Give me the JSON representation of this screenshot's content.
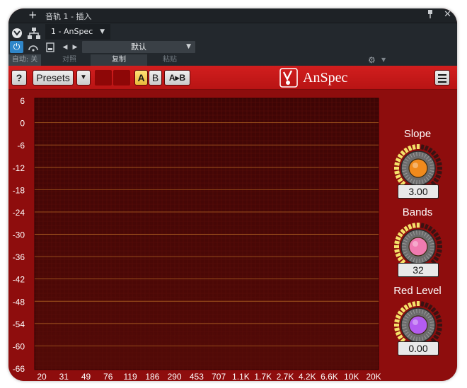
{
  "host": {
    "window_title": "音轨 1 - 插入",
    "add_icon": "+",
    "slot_label": "1 - AnSpec",
    "preset_name": "默认",
    "auto_label": "自动: 关",
    "compare_label": "对照",
    "copy_label": "复制",
    "paste_label": "粘贴"
  },
  "plugin": {
    "help_label": "?",
    "presets_label": "Presets",
    "preset_menu_glyph": "▼",
    "a_label": "A",
    "b_label": "B",
    "ab_label": "A▸B",
    "name": "AnSpec",
    "colors": {
      "accent_red": "#c41818",
      "knob_orange": "#f08a1c",
      "knob_pink": "#f07bb0",
      "knob_purple": "#b35cf0",
      "knob_arc": "#f4e26a"
    }
  },
  "analyzer": {
    "y_ticks": [
      "6",
      "0",
      "-6",
      "-12",
      "-18",
      "-24",
      "-30",
      "-36",
      "-42",
      "-48",
      "-54",
      "-60",
      "-66"
    ],
    "x_ticks": [
      "20",
      "31",
      "49",
      "76",
      "119",
      "186",
      "290",
      "453",
      "707",
      "1.1K",
      "1.7K",
      "2.7K",
      "4.2K",
      "6.6K",
      "10K",
      "20K"
    ]
  },
  "controls": [
    {
      "label": "Slope",
      "value": "3.00",
      "level": 0.5
    },
    {
      "label": "Bands",
      "value": "32",
      "level": 0.5
    },
    {
      "label": "Red Level",
      "value": "0.00",
      "level": 0.5
    }
  ]
}
